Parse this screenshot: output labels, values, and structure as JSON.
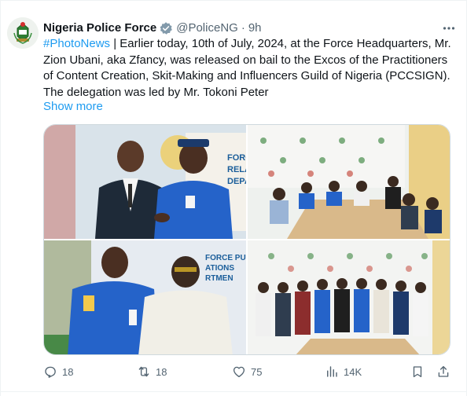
{
  "author": {
    "display_name": "Nigeria Police Force",
    "handle": "@PoliceNG",
    "separator": "·",
    "time": "9h",
    "verified": true
  },
  "tweet": {
    "hashtag": "#PhotoNews",
    "body": " | Earlier today, 10th of July, 2024, at the Force Headquarters, Mr. Zion Ubani, aka Zfancy, was released on bail to the Excos of the Practitioners of Content Creation, Skit-Making and Influencers Guild of Nigeria (PCCSIGN). The delegation was led by Mr. Tokoni Peter",
    "show_more": "Show more"
  },
  "media": {
    "photos": [
      {
        "name": "photo-handshake",
        "background_text": "FORCE RELA DEPA"
      },
      {
        "name": "photo-meeting-table"
      },
      {
        "name": "photo-officer-and-guest",
        "background_text": "FORCE PUB ATIONS RTMEN"
      },
      {
        "name": "photo-group"
      }
    ]
  },
  "actions": {
    "replies": "18",
    "reposts": "18",
    "likes": "75",
    "views": "14K"
  },
  "colors": {
    "accent": "#1d9bf0",
    "secondary_text": "#536471",
    "police_blue": "#2563c9",
    "border": "#cfd9de"
  }
}
